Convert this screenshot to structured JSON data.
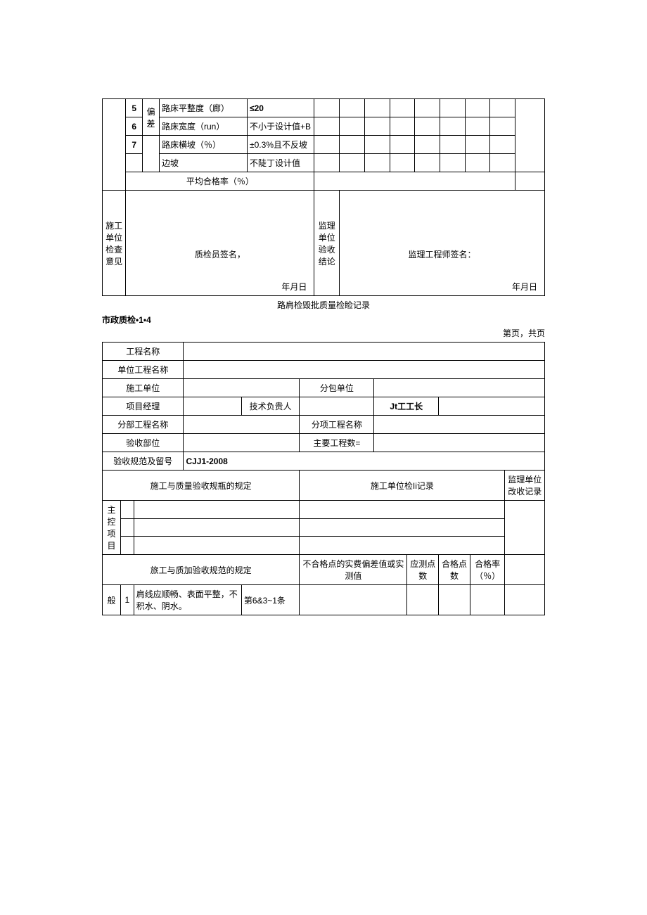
{
  "table1": {
    "rows": [
      {
        "num": "5",
        "side": "偏",
        "name": "路床平整度（廊）",
        "spec": "≤20"
      },
      {
        "num": "6",
        "side": "差",
        "name": "路床宽度（run）",
        "spec": "不小于设计值+B"
      },
      {
        "num": "7",
        "side": "",
        "name": "路床横坡（％）",
        "spec": "±0.3%且不反坡"
      },
      {
        "num": "",
        "side": "",
        "name": "边坡",
        "spec": "不陡丁设计值"
      }
    ],
    "avg_label": "平均合格率（％）",
    "left_block": "施工单位检查意见",
    "left_sig": "质检员签名，",
    "left_date": "年月日",
    "right_block": "监理单位验收结论",
    "right_sig": "监理工程师签名：",
    "right_date": "年月日"
  },
  "mid": {
    "title": "路肩检毁批质量检睑记录",
    "sublabel": "市政质检•1•4",
    "page": "第页，共页"
  },
  "table2": {
    "r1": "工程名称",
    "r2": "单位工程名称",
    "r3a": "施工单位",
    "r3b": "分包单位",
    "r4a": "项目经理",
    "r4b": "技术负贵人",
    "r4c": "Jt工工长",
    "r5a": "分部工程名称",
    "r5b": "分项工程名称",
    "r6a": "验收部位",
    "r6b": "主要工程数=",
    "r7a": "验收规范及留号",
    "r7b": "CJJ1-2008",
    "h1": "施工与质量验收规瓶的规定",
    "h2": "施工单位检Ii记录",
    "h3": "监理单位改收记录",
    "lblock": "主控项目",
    "h4": "旅工与质加验收规范的规定",
    "h5": "不合格点的实费偏差值或实测值",
    "h6": "应测点数",
    "h7": "合格点数",
    "h8": "合格率（％）",
    "lastblock": "般",
    "lastnum": "1",
    "lastdesc": "肩线应顺畅、表面平整，不积水、阴水。",
    "lastref": "第6&3~1条"
  }
}
